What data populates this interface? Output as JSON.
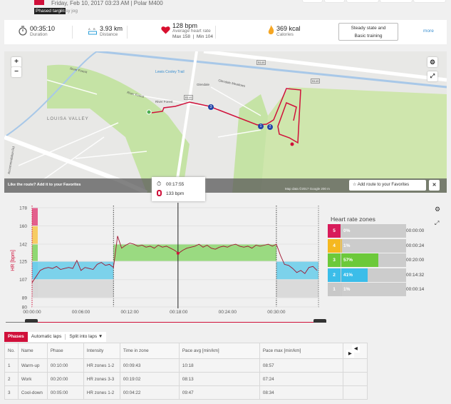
{
  "header": {
    "date_device": "Friday, Feb 10, 2017 03:23 AM | Polar M400",
    "badge": "Phased target",
    "target_name": "Easy jog"
  },
  "summary": {
    "duration": {
      "value": "00:35:10",
      "label": "Duration"
    },
    "distance": {
      "value": "3.93 km",
      "label": "Distance"
    },
    "heart_rate": {
      "value": "128 bpm",
      "label": "Average heart rate",
      "minmax": "Max 158  |  Min 104"
    },
    "calories": {
      "value": "369 kcal",
      "label": "Calories"
    },
    "benefit_line1": "Steady state and",
    "benefit_line2": "Basic training",
    "more": "more"
  },
  "map": {
    "labels": [
      "Lewis Cooley Trail",
      "River Forest",
      "River Forest",
      "River Forest",
      "Glendale",
      "Glendale Meadows",
      "LOUISA VALLEY",
      "Accommodation Rd",
      "B149",
      "B149",
      "B149"
    ],
    "fav_prompt": "Like the route?  Add it to your Favorites",
    "fav_button": "Add route to your Favorites",
    "close": "✕",
    "attribution": "Map data ©2017 Google   200 m",
    "zoom_in": "+",
    "zoom_out": "−",
    "route_markers": [
      "1",
      "2",
      "3"
    ]
  },
  "tooltip": {
    "time": "00:17:55",
    "hr": "133 bpm"
  },
  "chart_data": {
    "type": "line",
    "ylabel": "HR [bpm]",
    "yticks": [
      178,
      160,
      142,
      125,
      107,
      89,
      80
    ],
    "xticks": [
      "00:00:00",
      "00:06:00",
      "00:12:00",
      "00:18:00",
      "00:24:00",
      "00:30:00"
    ],
    "xlim_min": [
      0,
      35.17
    ],
    "ylim": [
      80,
      178
    ],
    "zones": [
      {
        "zone": 1,
        "from": 89,
        "to": 107,
        "color": "#d3d3d3"
      },
      {
        "zone": 2,
        "from": 107,
        "to": 125,
        "color": "#56c8ea"
      },
      {
        "zone": 3,
        "from": 125,
        "to": 142,
        "color": "#7ed35c"
      },
      {
        "zone": 4,
        "from": 142,
        "to": 160,
        "color": "#f7c54a"
      },
      {
        "zone": 5,
        "from": 160,
        "to": 178,
        "color": "#e0457b"
      }
    ],
    "phases": [
      {
        "name": "Warm-up",
        "start": 0,
        "end": 10,
        "zones": [
          1,
          2
        ]
      },
      {
        "name": "Work",
        "start": 10,
        "end": 30,
        "zones": [
          3,
          3
        ]
      },
      {
        "name": "Cool-down",
        "start": 30,
        "end": 35.17,
        "zones": [
          1,
          2
        ]
      }
    ],
    "step_min": 0.5,
    "hr": [
      104,
      110,
      116,
      118,
      119,
      118,
      120,
      117,
      118,
      119,
      118,
      126,
      116,
      119,
      118,
      117,
      122,
      124,
      121,
      122,
      119,
      150,
      138,
      141,
      143,
      142,
      140,
      141,
      139,
      140,
      138,
      141,
      139,
      140,
      138,
      136,
      133,
      136,
      138,
      139,
      140,
      142,
      139,
      141,
      138,
      137,
      139,
      140,
      139,
      141,
      142,
      140,
      139,
      140,
      138,
      141,
      140,
      141,
      142,
      140,
      142,
      131,
      122,
      121,
      118,
      114,
      116,
      113,
      119,
      120,
      116
    ],
    "cursor": {
      "min": 17.92,
      "hr": 133
    }
  },
  "zones_panel": {
    "title": "Heart rate zones",
    "rows": [
      {
        "num": "5",
        "pct": "0%",
        "frac": 0.0,
        "time": "00:00:00",
        "color": "#d81b5a"
      },
      {
        "num": "4",
        "pct": "1%",
        "frac": 0.01,
        "time": "00:00:24",
        "color": "#f5b820"
      },
      {
        "num": "3",
        "pct": "57%",
        "frac": 0.57,
        "time": "00:20:00",
        "color": "#6cc93a"
      },
      {
        "num": "2",
        "pct": "41%",
        "frac": 0.41,
        "time": "00:14:32",
        "color": "#3bbde9"
      },
      {
        "num": "1",
        "pct": "1%",
        "frac": 0.01,
        "time": "00:00:14",
        "color": "#c8c8c8"
      }
    ]
  },
  "tabs": {
    "phases": "Phases",
    "auto_laps": "Automatic laps",
    "split": "Split into laps ▼"
  },
  "table": {
    "headers": [
      "No.",
      "Name",
      "Phase",
      "Intensity",
      "Time in zone",
      "Pace avg [min/km]",
      "Pace max [min/km]"
    ],
    "rows": [
      [
        "1",
        "Warm-up",
        "00:10:00",
        "HR zones 1-2",
        "00:09:43",
        "10:18",
        "08:57"
      ],
      [
        "2",
        "Work",
        "00:20:00",
        "HR zones 3-3",
        "00:19:02",
        "08:13",
        "07:24"
      ],
      [
        "3",
        "Cool-down",
        "00:05:00",
        "HR zones 1-2",
        "00:04:22",
        "09:47",
        "08:34"
      ]
    ],
    "prev": "◀",
    "next": "▶"
  }
}
